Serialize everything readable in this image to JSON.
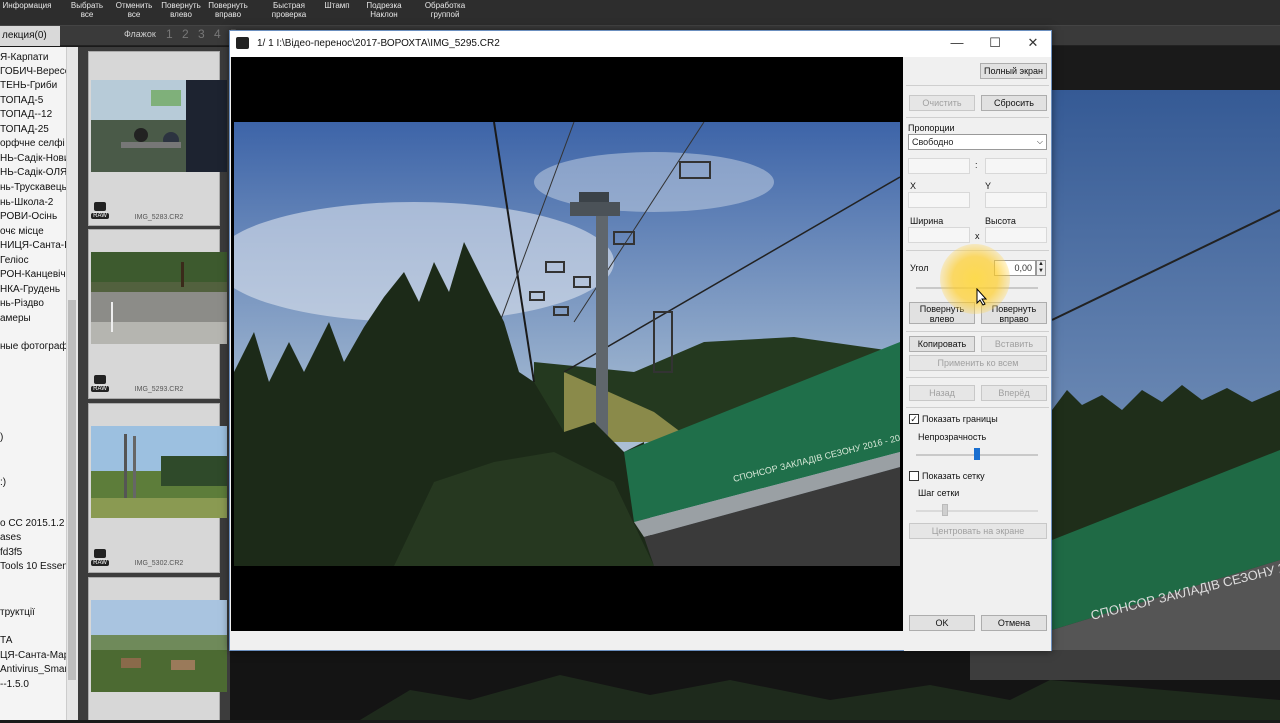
{
  "toolbar": {
    "buttons": [
      {
        "line1": "Информация",
        "line2": ""
      },
      {
        "line1": "Выбрать",
        "line2": "все"
      },
      {
        "line1": "Отменить",
        "line2": "все"
      },
      {
        "line1": "Повернуть",
        "line2": "влево"
      },
      {
        "line1": "Повернуть",
        "line2": "вправо"
      },
      {
        "line1": "Быстрая",
        "line2": "проверка"
      },
      {
        "line1": "Штамп",
        "line2": ""
      },
      {
        "line1": "Подрезка",
        "line2": "Наклон"
      },
      {
        "line1": "Обработка",
        "line2": "группой"
      }
    ]
  },
  "collection_tab": "лекция(0)",
  "flags_label": "Флажок",
  "flag_numbers": "1 2 3 4 5",
  "sidebar": {
    "items": [
      "Я-Карпати",
      "ГОБИЧ-Вересе",
      "ТЕНЬ-Гриби",
      "ТОПАД-5",
      "ТОПАД--12",
      "ТОПАД-25",
      "орфчне селфі",
      "НЬ-Садік-Новий р",
      "НЬ-Садік-ОЛЯ",
      "нь-Трускавець",
      "нь-Школа-2",
      "РОВИ-Осінь",
      "очє місце",
      "НИЦЯ-Санта-І",
      "Геліос",
      "РОН-Канцевіч",
      "НКА-Грудень",
      "нь-Різдво",
      "амеры",
      "ные фотограф",
      ")",
      ":)",
      "o CC 2015.1.2 (2",
      "ases",
      "fd3f5",
      "Tools 10 Essent",
      "труктції",
      "ТА",
      "ЦЯ-Санта-Мар",
      "Antivirus_Smart",
      "--1.5.0"
    ]
  },
  "thumbnails": [
    {
      "filename": "IMG_5283.CR2",
      "raw": "RAW"
    },
    {
      "filename": "IMG_5293.CR2",
      "raw": "RAW"
    },
    {
      "filename": "IMG_5302.CR2",
      "raw": "RAW"
    }
  ],
  "dialog": {
    "title": "1/  1  I:\\Відео-перенос\\2017-ВОРОХТА\\IMG_5295.CR2",
    "banner_text": "СПОНСОР ЗАКЛАДІВ СЕЗОНУ 2016 - 2017",
    "panel": {
      "fullscreen": "Полный экран",
      "clear": "Очистить",
      "reset": "Сбросить",
      "proportions_label": "Пропорции",
      "proportions_value": "Свободно",
      "colon": ":",
      "x_label": "X",
      "y_label": "Y",
      "width_label": "Ширина",
      "times": "x",
      "height_label": "Высота",
      "angle_label": "Угол",
      "angle_value": "0,00",
      "rotate_left": "Повернуть влево",
      "rotate_right": "Повернуть вправо",
      "copy": "Копировать",
      "paste": "Вставить",
      "apply_all": "Применить ко всем",
      "back": "Назад",
      "forward": "Вперёд",
      "show_borders": "Показать границы",
      "opacity": "Непрозрачность",
      "show_grid": "Показать сетку",
      "grid_step": "Шаг сетки",
      "center": "Центровать на экране",
      "ok": "OK",
      "cancel": "Отмена"
    }
  },
  "bg_banner_text": "СПОНСОР ЗАКЛАДІВ СЕЗОНУ 2016 - 2017",
  "slider_levels": {
    "opacity": 0.5,
    "angle": 0.5
  }
}
